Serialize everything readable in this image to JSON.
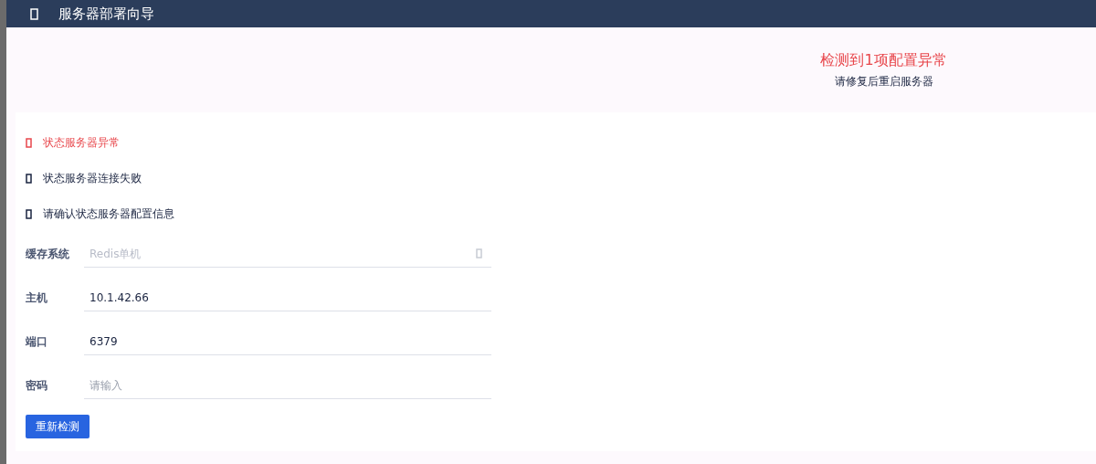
{
  "header": {
    "title": "服务器部署向导"
  },
  "summary": {
    "headline": "检测到1项配置异常",
    "hint": "请修复后重启服务器"
  },
  "messages": [
    {
      "kind": "error",
      "text": "状态服务器异常"
    },
    {
      "kind": "info",
      "text": "状态服务器连接失败"
    },
    {
      "kind": "info",
      "text": "请确认状态服务器配置信息"
    }
  ],
  "form": {
    "fields": [
      {
        "kind": "select",
        "label": "缓存系统",
        "placeholder": "Redis单机"
      },
      {
        "kind": "text",
        "label": "主机",
        "value": "10.1.42.66"
      },
      {
        "kind": "text",
        "label": "端口",
        "value": "6379"
      },
      {
        "kind": "text",
        "label": "密码",
        "placeholder": "请输入"
      }
    ],
    "button": "重新检测"
  }
}
